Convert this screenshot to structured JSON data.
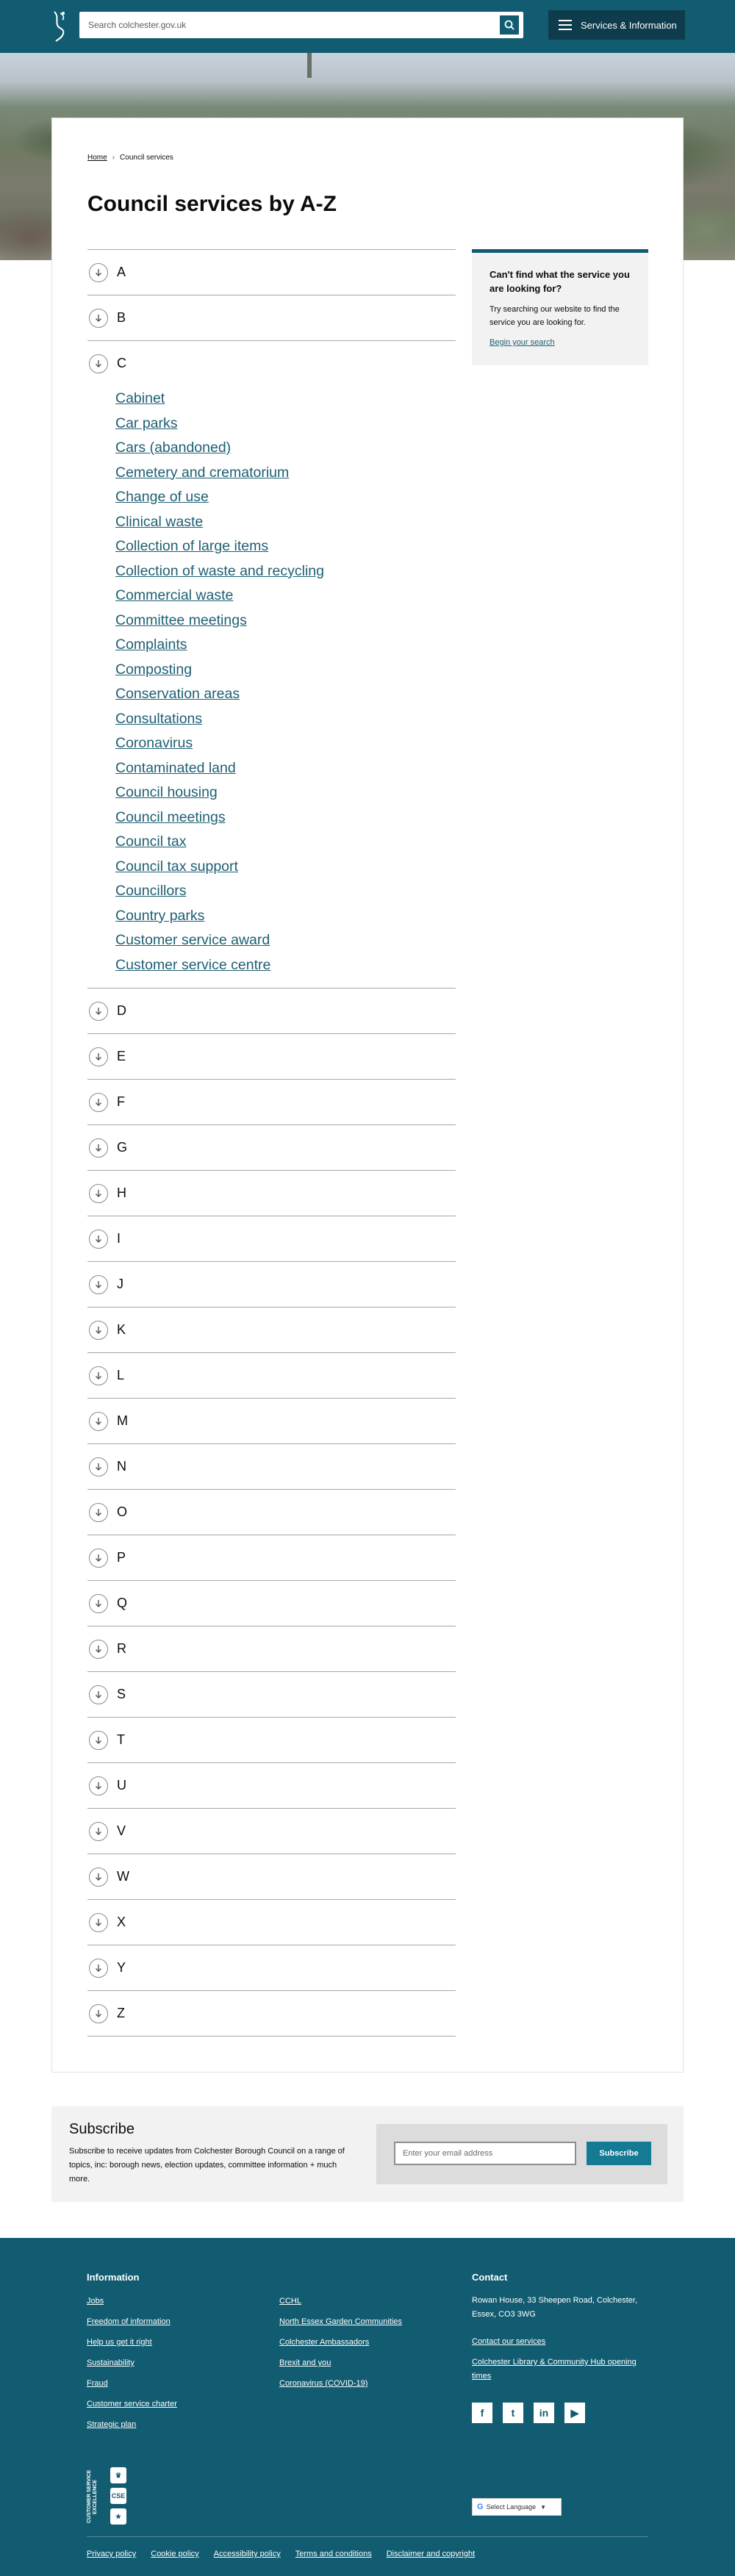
{
  "header": {
    "search_placeholder": "Search colchester.gov.uk",
    "menu_label": "Services & Information"
  },
  "breadcrumb": {
    "home": "Home",
    "current": "Council services"
  },
  "page_title": "Council services by A-Z",
  "az": [
    {
      "letter": "A",
      "expanded": false
    },
    {
      "letter": "B",
      "expanded": false
    },
    {
      "letter": "C",
      "expanded": true,
      "links": [
        "Cabinet",
        "Car parks",
        "Cars (abandoned)",
        "Cemetery and crematorium",
        "Change of use",
        "Clinical waste",
        "Collection of large items",
        "Collection of waste and recycling",
        "Commercial waste",
        "Committee meetings",
        "Complaints",
        "Composting",
        "Conservation areas",
        "Consultations",
        "Coronavirus",
        "Contaminated land",
        "Council housing",
        "Council meetings",
        "Council tax",
        "Council tax support",
        "Councillors",
        "Country parks",
        "Customer service award",
        "Customer service centre"
      ]
    },
    {
      "letter": "D",
      "expanded": false
    },
    {
      "letter": "E",
      "expanded": false
    },
    {
      "letter": "F",
      "expanded": false
    },
    {
      "letter": "G",
      "expanded": false
    },
    {
      "letter": "H",
      "expanded": false
    },
    {
      "letter": "I",
      "expanded": false
    },
    {
      "letter": "J",
      "expanded": false
    },
    {
      "letter": "K",
      "expanded": false
    },
    {
      "letter": "L",
      "expanded": false
    },
    {
      "letter": "M",
      "expanded": false
    },
    {
      "letter": "N",
      "expanded": false
    },
    {
      "letter": "O",
      "expanded": false
    },
    {
      "letter": "P",
      "expanded": false
    },
    {
      "letter": "Q",
      "expanded": false
    },
    {
      "letter": "R",
      "expanded": false
    },
    {
      "letter": "S",
      "expanded": false
    },
    {
      "letter": "T",
      "expanded": false
    },
    {
      "letter": "U",
      "expanded": false
    },
    {
      "letter": "V",
      "expanded": false
    },
    {
      "letter": "W",
      "expanded": false
    },
    {
      "letter": "X",
      "expanded": false
    },
    {
      "letter": "Y",
      "expanded": false
    },
    {
      "letter": "Z",
      "expanded": false
    }
  ],
  "aside": {
    "title": "Can't find what the service you are looking for?",
    "text": "Try searching our website to find the service you are looking for.",
    "link": "Begin your search"
  },
  "subscribe": {
    "title": "Subscribe",
    "text": "Subscribe to receive updates from Colchester Borough Council on a range of topics, inc: borough news, election updates, committee information + much more.",
    "email_placeholder": "Enter your email address",
    "button": "Subscribe"
  },
  "footer": {
    "information_title": "Information",
    "info_col1": [
      "Jobs",
      "Freedom of information",
      "Help us get it right",
      "Sustainability",
      "Fraud",
      "Customer service charter",
      "Strategic plan"
    ],
    "info_col2": [
      "CCHL",
      "North Essex Garden Communities",
      "Colchester Ambassadors",
      "Brexit and you",
      "Coronavirus (COVID-19)"
    ],
    "contact_title": "Contact",
    "address": "Rowan House, 33 Sheepen Road, Colchester, Essex, CO3 3WG",
    "contact_link": "Contact our services",
    "library_link": "Colchester Library & Community Hub opening times",
    "socials": [
      {
        "name": "facebook-icon",
        "glyph": "f"
      },
      {
        "name": "twitter-icon",
        "glyph": "t"
      },
      {
        "name": "linkedin-icon",
        "glyph": "in"
      },
      {
        "name": "youtube-icon",
        "glyph": "▶"
      }
    ],
    "cse_text": "CUSTOMER SERVICE EXCELLENCE",
    "language": "Select Language",
    "bottom_links": [
      "Privacy policy",
      "Cookie policy",
      "Accessibility policy",
      "Terms and conditions",
      "Disclaimer and copyright"
    ]
  },
  "colors": {
    "brand": "#125c71",
    "link": "#1e5f73",
    "menu_dark": "#0e3c4c",
    "subscribe_button": "#157a94"
  }
}
